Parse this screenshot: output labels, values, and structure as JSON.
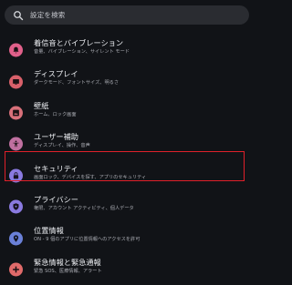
{
  "search": {
    "placeholder": "設定を検索",
    "icon": "search-icon"
  },
  "items": [
    {
      "title": "着信音とバイブレーション",
      "sub": "音量、バイブレーション、サイレント モード",
      "icon": "bell-icon",
      "color": "#e0608a"
    },
    {
      "title": "ディスプレイ",
      "sub": "ダークモード、フォントサイズ、明るさ",
      "icon": "display-icon",
      "color": "#d8606a"
    },
    {
      "title": "壁紙",
      "sub": "ホーム、ロック画面",
      "icon": "wallpaper-icon",
      "color": "#d8707a"
    },
    {
      "title": "ユーザー補助",
      "sub": "ディスプレイ、操作、音声",
      "icon": "accessibility-icon",
      "color": "#c070a0"
    },
    {
      "title": "セキュリティ",
      "sub": "画面ロック、デバイスを探す、アプリのセキュリティ",
      "icon": "lock-icon",
      "color": "#8a7ae0"
    },
    {
      "title": "プライバシー",
      "sub": "権限、アカウント アクティビティ、個人データ",
      "icon": "privacy-icon",
      "color": "#8a7ae0"
    },
    {
      "title": "位置情報",
      "sub": "ON - 9 個のアプリに位置情報へのアクセスを許可",
      "icon": "location-icon",
      "color": "#6a80d8"
    },
    {
      "title": "緊急情報と緊急通報",
      "sub": "緊急 SOS、医療情報、アラート",
      "icon": "emergency-icon",
      "color": "#e06a6a"
    }
  ]
}
